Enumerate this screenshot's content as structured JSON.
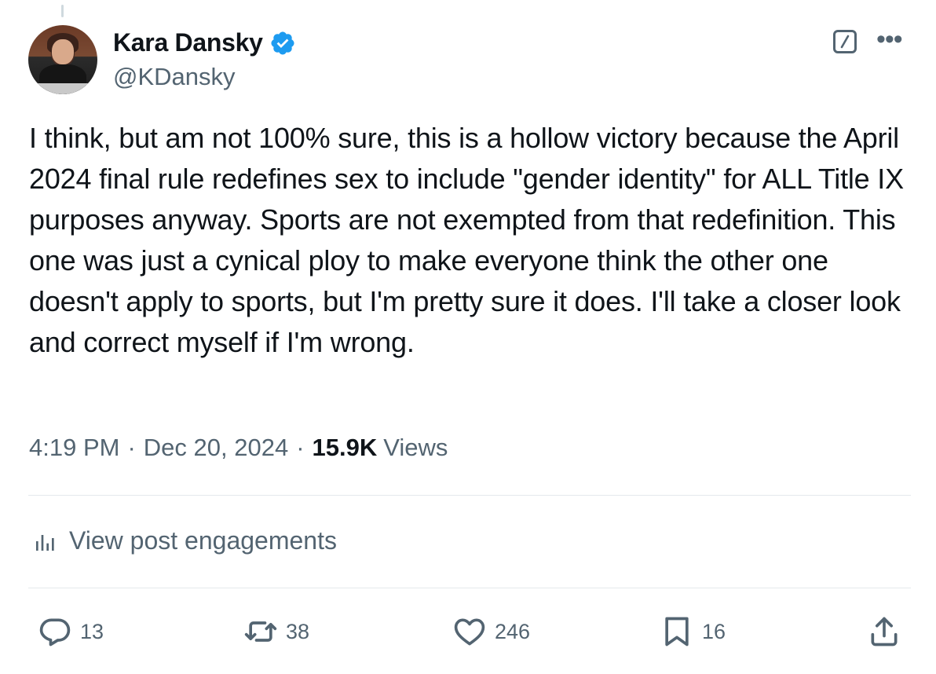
{
  "author": {
    "name": "Kara Dansky",
    "handle": "@KDansky",
    "verified_color": "#1d9bf0"
  },
  "post": {
    "text": "I think, but am not 100% sure, this is a hollow victory because the April 2024 final rule redefines sex to include \"gender identity\" for ALL Title IX purposes anyway. Sports are not exempted from that redefinition. This one was just a cynical ploy to make everyone think the other one doesn't apply to sports, but I'm pretty sure it does. I'll take a closer look and correct myself if I'm wrong.",
    "time": "4:19 PM",
    "date": "Dec 20, 2024",
    "separator": "·",
    "views_count": "15.9K",
    "views_label": "Views"
  },
  "engagements_label": "View post engagements",
  "actions": {
    "replies": "13",
    "reposts": "38",
    "likes": "246",
    "bookmarks": "16"
  },
  "icons": {
    "grok": "grok-icon",
    "more": "more-icon",
    "analytics": "analytics-icon",
    "reply": "reply-icon",
    "repost": "repost-icon",
    "like": "heart-icon",
    "bookmark": "bookmark-icon",
    "share": "share-icon"
  },
  "colors": {
    "text": "#0f1419",
    "secondary": "#536471",
    "divider": "#e4e9ec"
  }
}
